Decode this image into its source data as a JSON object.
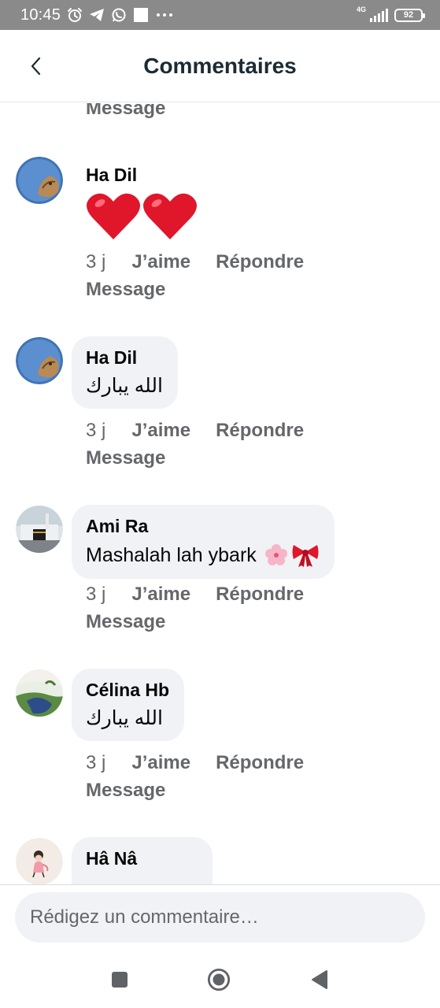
{
  "status_bar": {
    "time": "10:45",
    "network": "4G",
    "battery": "92"
  },
  "header": {
    "title": "Commentaires"
  },
  "partial_top": {
    "message_label": "Message"
  },
  "comments": [
    {
      "author": "Ha Dil",
      "text": "",
      "content_type": "two-red-hearts-emoji",
      "time": "3 j",
      "like_label": "J’aime",
      "reply_label": "Répondre",
      "message_label": "Message"
    },
    {
      "author": "Ha Dil",
      "text": "الله يبارك",
      "time": "3 j",
      "like_label": "J’aime",
      "reply_label": "Répondre",
      "message_label": "Message"
    },
    {
      "author": "Ami Ra",
      "text": "Mashalah lah ybark",
      "emojis": [
        "cherry-blossom-emoji",
        "ribbon-emoji"
      ],
      "time": "3 j",
      "like_label": "J’aime",
      "reply_label": "Répondre",
      "message_label": "Message"
    },
    {
      "author": "Célina Hb",
      "text": "الله يبارك",
      "time": "3 j",
      "like_label": "J’aime",
      "reply_label": "Répondre",
      "message_label": "Message"
    },
    {
      "author": "Hâ Nâ",
      "text": ""
    }
  ],
  "composer": {
    "placeholder": "Rédigez un commentaire…",
    "value": ""
  },
  "icons": {
    "back": "chevron-left-icon",
    "nav_recents": "square-icon",
    "nav_home": "circle-icon",
    "nav_back": "triangle-back-icon"
  },
  "colors": {
    "status_bar_bg": "#8a8a8a",
    "bubble_bg": "#f0f2f5",
    "secondary_text": "#65676b",
    "heart_red": "#e0162b",
    "title_text": "#1c2b33"
  }
}
